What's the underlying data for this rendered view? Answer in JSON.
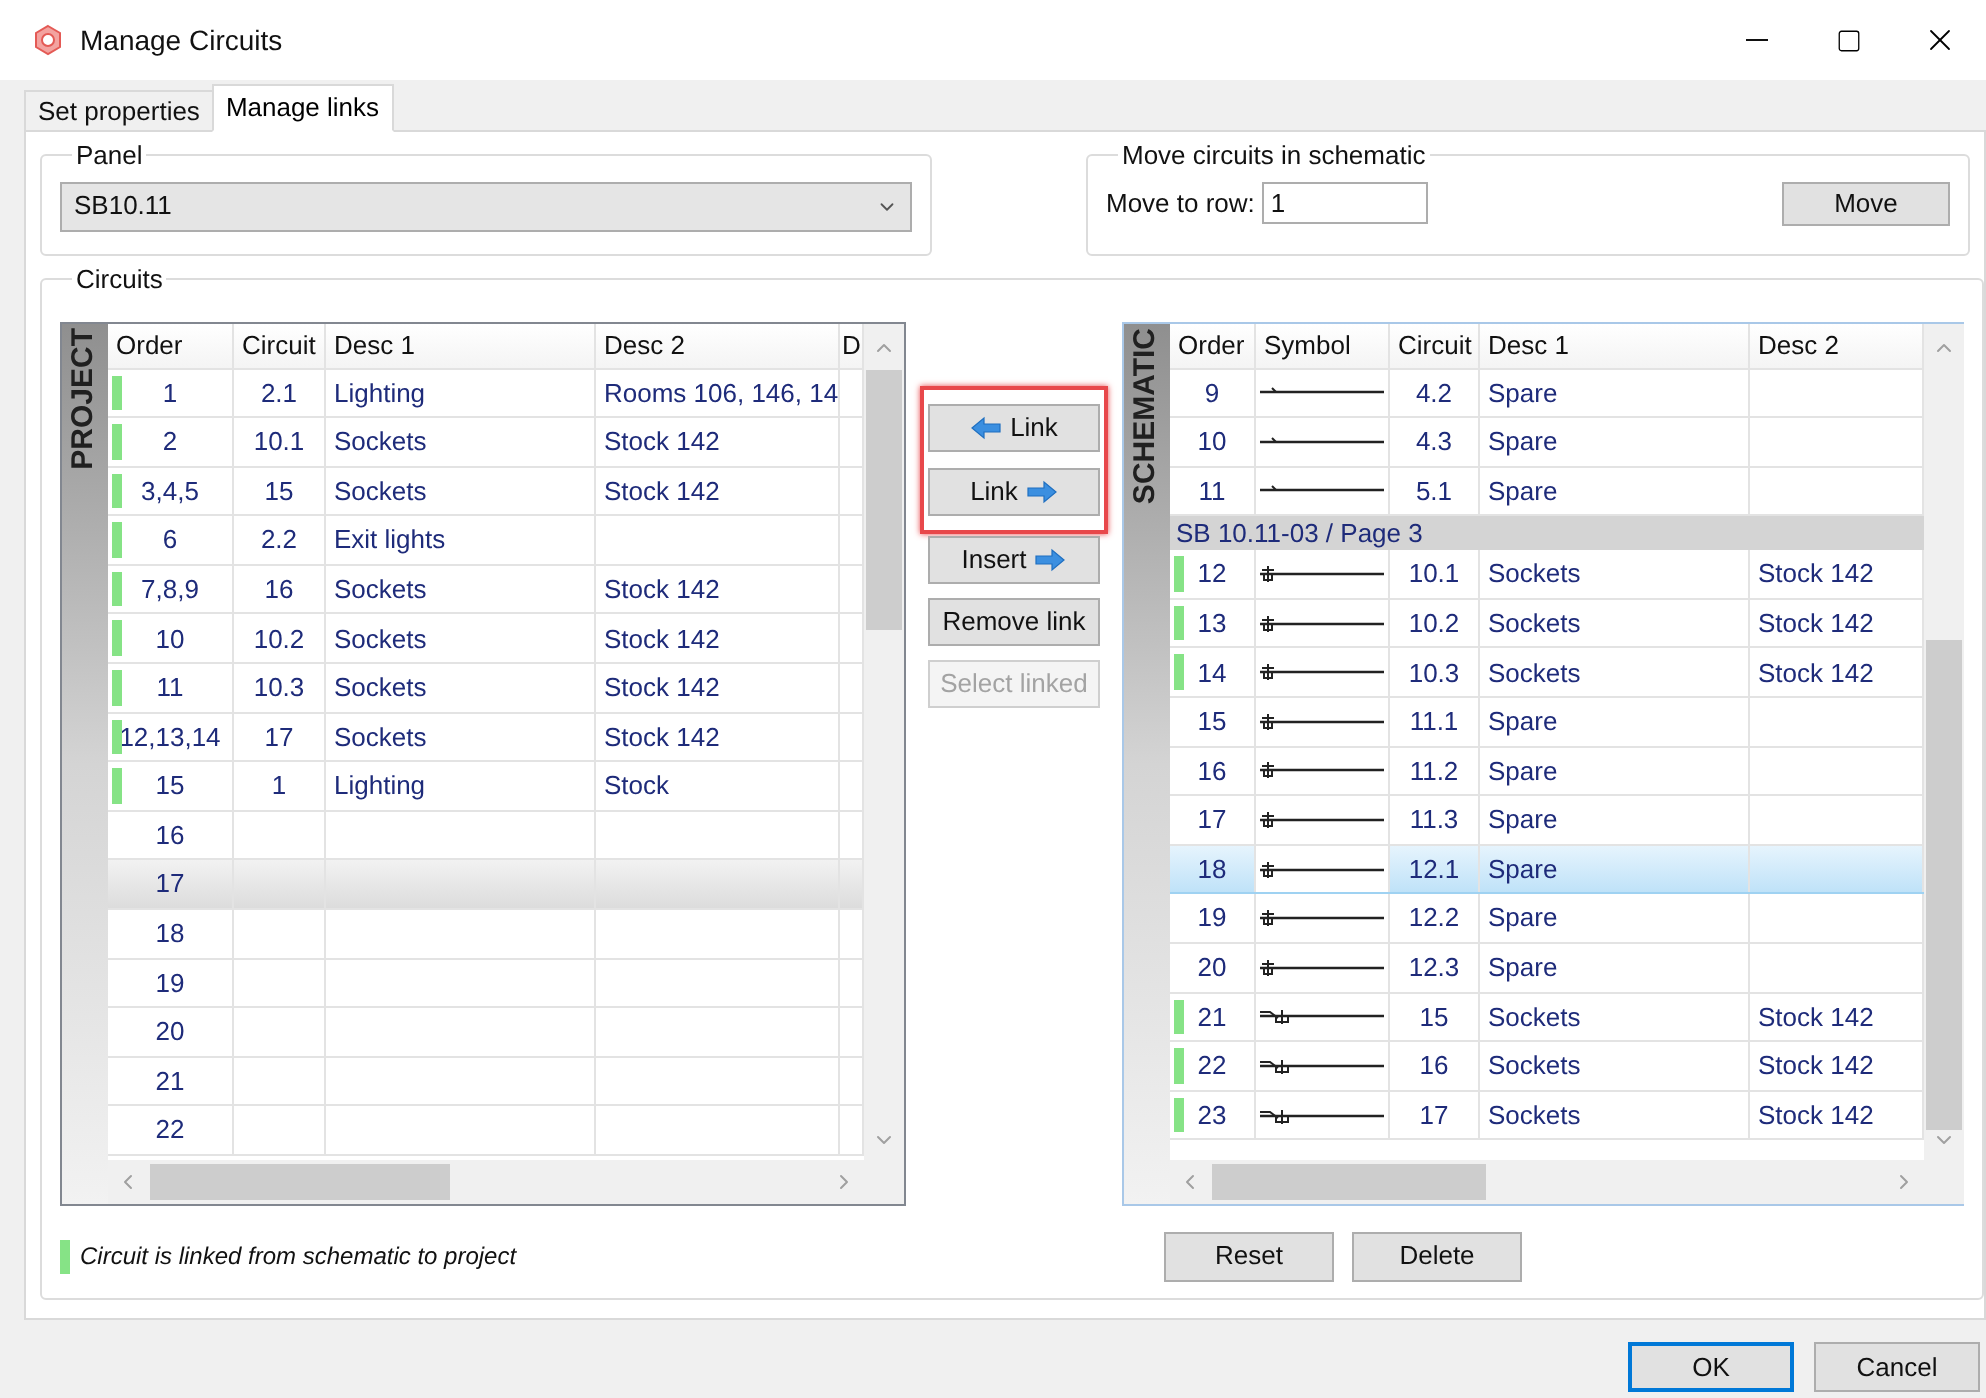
{
  "window": {
    "title": "Manage Circuits"
  },
  "tabs": [
    {
      "label": "Set properties",
      "selected": false
    },
    {
      "label": "Manage links",
      "selected": true
    }
  ],
  "panel": {
    "legend": "Panel",
    "value": "SB10.11"
  },
  "move": {
    "legend": "Move circuits in schematic",
    "label": "Move to row:",
    "value": "1",
    "button": "Move"
  },
  "circuits": {
    "legend": "Circuits",
    "project": {
      "band": "PROJECT",
      "columns": [
        "Order",
        "Circuit",
        "Desc 1",
        "Desc 2",
        "D"
      ],
      "rows": [
        {
          "order": "1",
          "circuit": "2.1",
          "desc_1": "Lighting",
          "desc_2": "Rooms 106, 146, 14",
          "linked": true,
          "selected": false
        },
        {
          "order": "2",
          "circuit": "10.1",
          "desc_1": "Sockets",
          "desc_2": "Stock 142",
          "linked": true,
          "selected": false
        },
        {
          "order": "3,4,5",
          "circuit": "15",
          "desc_1": "Sockets",
          "desc_2": "Stock 142",
          "linked": true,
          "selected": false
        },
        {
          "order": "6",
          "circuit": "2.2",
          "desc_1": "Exit lights",
          "linked": true,
          "selected": false
        },
        {
          "order": "7,8,9",
          "circuit": "16",
          "desc_1": "Sockets",
          "desc_2": "Stock 142",
          "linked": true,
          "selected": false
        },
        {
          "order": "10",
          "circuit": "10.2",
          "desc_1": "Sockets",
          "desc_2": "Stock 142",
          "linked": true,
          "selected": false
        },
        {
          "order": "11",
          "circuit": "10.3",
          "desc_1": "Sockets",
          "desc_2": "Stock 142",
          "linked": true,
          "selected": false
        },
        {
          "order": "12,13,14",
          "circuit": "17",
          "desc_1": "Sockets",
          "desc_2": "Stock 142",
          "linked": true,
          "selected": false
        },
        {
          "order": "15",
          "circuit": "1",
          "desc_1": "Lighting",
          "desc_2": "Stock",
          "linked": true,
          "selected": false
        },
        {
          "order": "16",
          "linked": false,
          "selected": false
        },
        {
          "order": "17",
          "linked": false,
          "selected": true
        },
        {
          "order": "18",
          "linked": false,
          "selected": false
        },
        {
          "order": "19",
          "linked": false,
          "selected": false
        },
        {
          "order": "20",
          "linked": false,
          "selected": false
        },
        {
          "order": "21",
          "linked": false,
          "selected": false
        },
        {
          "order": "22",
          "linked": false,
          "selected": false
        }
      ]
    },
    "actions": [
      {
        "label": "Link",
        "kind": "left-arrow",
        "highlighted": true,
        "disabled": false
      },
      {
        "label": "Link",
        "kind": "right-arrow",
        "highlighted": true,
        "disabled": false
      },
      {
        "label": "Insert",
        "kind": "right-arrow",
        "highlighted": false,
        "disabled": false
      },
      {
        "label": "Remove link",
        "kind": "plain",
        "highlighted": false,
        "disabled": false
      },
      {
        "label": "Select linked",
        "kind": "plain",
        "highlighted": false,
        "disabled": true
      }
    ],
    "schematic": {
      "band": "SCHEMATIC",
      "columns": [
        "Order",
        "Symbol",
        "Circuit",
        "Desc 1",
        "Desc 2"
      ],
      "rows": [
        {
          "kind": "plain",
          "order": "9",
          "circuit": "4.2",
          "desc_1": "Spare",
          "linked": false,
          "selected": false
        },
        {
          "kind": "plain",
          "order": "10",
          "circuit": "4.3",
          "desc_1": "Spare",
          "linked": false,
          "selected": false
        },
        {
          "kind": "plain",
          "order": "11",
          "circuit": "5.1",
          "desc_1": "Spare",
          "linked": false,
          "selected": false
        },
        {
          "kind": "group",
          "label": "SB 10.11-03 / Page 3"
        },
        {
          "kind": "socket",
          "order": "12",
          "circuit": "10.1",
          "desc_1": "Sockets",
          "desc_2": "Stock 142",
          "linked": true,
          "selected": false
        },
        {
          "kind": "socket",
          "order": "13",
          "circuit": "10.2",
          "desc_1": "Sockets",
          "desc_2": "Stock 142",
          "linked": true,
          "selected": false
        },
        {
          "kind": "socket",
          "order": "14",
          "circuit": "10.3",
          "desc_1": "Sockets",
          "desc_2": "Stock 142",
          "linked": true,
          "selected": false
        },
        {
          "kind": "socket",
          "order": "15",
          "circuit": "11.1",
          "desc_1": "Spare",
          "linked": false,
          "selected": false
        },
        {
          "kind": "socket",
          "order": "16",
          "circuit": "11.2",
          "desc_1": "Spare",
          "linked": false,
          "selected": false
        },
        {
          "kind": "socket",
          "order": "17",
          "circuit": "11.3",
          "desc_1": "Spare",
          "linked": false,
          "selected": false
        },
        {
          "kind": "socket",
          "order": "18",
          "circuit": "12.1",
          "desc_1": "Spare",
          "linked": false,
          "selected": true
        },
        {
          "kind": "socket",
          "order": "19",
          "circuit": "12.2",
          "desc_1": "Spare",
          "linked": false,
          "selected": false
        },
        {
          "kind": "socket",
          "order": "20",
          "circuit": "12.3",
          "desc_1": "Spare",
          "linked": false,
          "selected": false
        },
        {
          "kind": "switched",
          "order": "21",
          "circuit": "15",
          "desc_1": "Sockets",
          "desc_2": "Stock 142",
          "linked": true,
          "selected": false
        },
        {
          "kind": "switched",
          "order": "22",
          "circuit": "16",
          "desc_1": "Sockets",
          "desc_2": "Stock 142",
          "linked": true,
          "selected": false
        },
        {
          "kind": "switched",
          "order": "23",
          "circuit": "17",
          "desc_1": "Sockets",
          "desc_2": "Stock 142",
          "linked": true,
          "selected": false
        }
      ]
    },
    "legend_text": "Circuit is linked from schematic to project",
    "buttons": [
      "Reset",
      "Delete"
    ]
  },
  "dialog_buttons": [
    {
      "label": "OK",
      "default": true
    },
    {
      "label": "Cancel",
      "default": false
    }
  ]
}
